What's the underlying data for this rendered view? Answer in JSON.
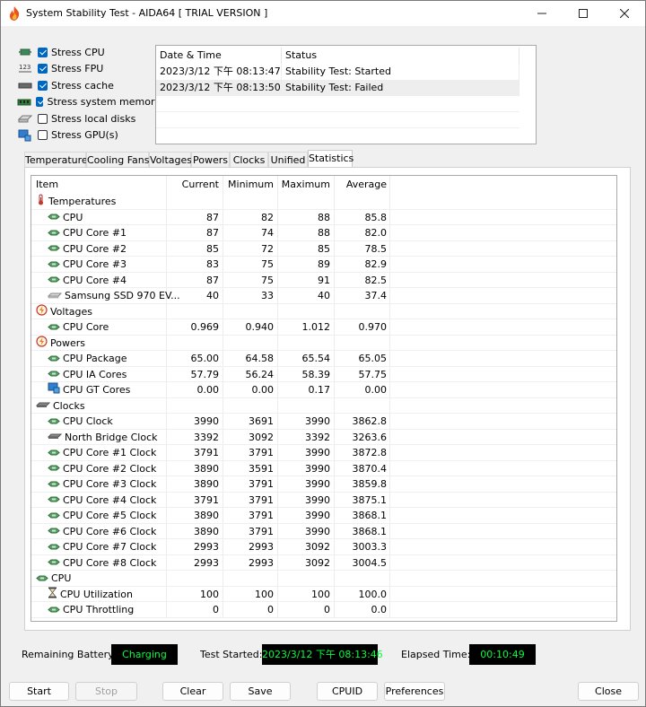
{
  "window": {
    "title": "System Stability Test - AIDA64  [ TRIAL VERSION ]",
    "controls": [
      "minimize",
      "maximize",
      "close"
    ]
  },
  "stress_options": [
    {
      "label": "Stress CPU",
      "checked": true,
      "icon": "cpu-chip-icon"
    },
    {
      "label": "Stress FPU",
      "checked": true,
      "icon": "fpu-123-icon"
    },
    {
      "label": "Stress cache",
      "checked": true,
      "icon": "cache-chip-icon"
    },
    {
      "label": "Stress system memory",
      "checked": true,
      "icon": "memory-module-icon"
    },
    {
      "label": "Stress local disks",
      "checked": false,
      "icon": "disk-drive-icon"
    },
    {
      "label": "Stress GPU(s)",
      "checked": false,
      "icon": "gpu-monitor-icon"
    }
  ],
  "log": {
    "headers": [
      "Date & Time",
      "Status"
    ],
    "rows": [
      {
        "datetime": "2023/3/12 下午 08:13:47",
        "status": "Stability Test: Started"
      },
      {
        "datetime": "2023/3/12 下午 08:13:50",
        "status": "Stability Test: Failed"
      }
    ]
  },
  "tabs": [
    "Temperatures",
    "Cooling Fans",
    "Voltages",
    "Powers",
    "Clocks",
    "Unified",
    "Statistics"
  ],
  "active_tab": "Statistics",
  "stats": {
    "headers": {
      "item": "Item",
      "current": "Current",
      "minimum": "Minimum",
      "maximum": "Maximum",
      "average": "Average"
    },
    "rows": [
      {
        "type": "group",
        "label": "Temperatures",
        "icon": "thermometer-icon"
      },
      {
        "type": "item",
        "label": "CPU",
        "icon": "sensor-icon",
        "current": "87",
        "minimum": "82",
        "maximum": "88",
        "average": "85.8"
      },
      {
        "type": "item",
        "label": "CPU Core #1",
        "icon": "sensor-icon",
        "current": "87",
        "minimum": "74",
        "maximum": "88",
        "average": "82.0"
      },
      {
        "type": "item",
        "label": "CPU Core #2",
        "icon": "sensor-icon",
        "current": "85",
        "minimum": "72",
        "maximum": "85",
        "average": "78.5"
      },
      {
        "type": "item",
        "label": "CPU Core #3",
        "icon": "sensor-icon",
        "current": "83",
        "minimum": "75",
        "maximum": "89",
        "average": "82.9"
      },
      {
        "type": "item",
        "label": "CPU Core #4",
        "icon": "sensor-icon",
        "current": "87",
        "minimum": "75",
        "maximum": "91",
        "average": "82.5"
      },
      {
        "type": "item",
        "label": "Samsung SSD 970 EV...",
        "icon": "ssd-icon",
        "current": "40",
        "minimum": "33",
        "maximum": "40",
        "average": "37.4"
      },
      {
        "type": "group",
        "label": "Voltages",
        "icon": "voltage-icon"
      },
      {
        "type": "item",
        "label": "CPU Core",
        "icon": "sensor-icon",
        "current": "0.969",
        "minimum": "0.940",
        "maximum": "1.012",
        "average": "0.970"
      },
      {
        "type": "group",
        "label": "Powers",
        "icon": "power-icon"
      },
      {
        "type": "item",
        "label": "CPU Package",
        "icon": "sensor-icon",
        "current": "65.00",
        "minimum": "64.58",
        "maximum": "65.54",
        "average": "65.05"
      },
      {
        "type": "item",
        "label": "CPU IA Cores",
        "icon": "sensor-icon",
        "current": "57.79",
        "minimum": "56.24",
        "maximum": "58.39",
        "average": "57.75"
      },
      {
        "type": "item",
        "label": "CPU GT Cores",
        "icon": "gpu-monitor-icon",
        "current": "0.00",
        "minimum": "0.00",
        "maximum": "0.17",
        "average": "0.00"
      },
      {
        "type": "group",
        "label": "Clocks",
        "icon": "clock-chip-icon"
      },
      {
        "type": "item",
        "label": "CPU Clock",
        "icon": "sensor-icon",
        "current": "3990",
        "minimum": "3691",
        "maximum": "3990",
        "average": "3862.8"
      },
      {
        "type": "item",
        "label": "North Bridge Clock",
        "icon": "chip-icon",
        "current": "3392",
        "minimum": "3092",
        "maximum": "3392",
        "average": "3263.6"
      },
      {
        "type": "item",
        "label": "CPU Core #1 Clock",
        "icon": "sensor-icon",
        "current": "3791",
        "minimum": "3791",
        "maximum": "3990",
        "average": "3872.8"
      },
      {
        "type": "item",
        "label": "CPU Core #2 Clock",
        "icon": "sensor-icon",
        "current": "3890",
        "minimum": "3591",
        "maximum": "3990",
        "average": "3870.4"
      },
      {
        "type": "item",
        "label": "CPU Core #3 Clock",
        "icon": "sensor-icon",
        "current": "3890",
        "minimum": "3791",
        "maximum": "3990",
        "average": "3859.8"
      },
      {
        "type": "item",
        "label": "CPU Core #4 Clock",
        "icon": "sensor-icon",
        "current": "3791",
        "minimum": "3791",
        "maximum": "3990",
        "average": "3875.1"
      },
      {
        "type": "item",
        "label": "CPU Core #5 Clock",
        "icon": "sensor-icon",
        "current": "3890",
        "minimum": "3791",
        "maximum": "3990",
        "average": "3868.1"
      },
      {
        "type": "item",
        "label": "CPU Core #6 Clock",
        "icon": "sensor-icon",
        "current": "3890",
        "minimum": "3791",
        "maximum": "3990",
        "average": "3868.1"
      },
      {
        "type": "item",
        "label": "CPU Core #7 Clock",
        "icon": "sensor-icon",
        "current": "2993",
        "minimum": "2993",
        "maximum": "3092",
        "average": "3003.3"
      },
      {
        "type": "item",
        "label": "CPU Core #8 Clock",
        "icon": "sensor-icon",
        "current": "2993",
        "minimum": "2993",
        "maximum": "3092",
        "average": "3004.5"
      },
      {
        "type": "group",
        "label": "CPU",
        "icon": "sensor-icon"
      },
      {
        "type": "item",
        "label": "CPU Utilization",
        "icon": "hourglass-icon",
        "current": "100",
        "minimum": "100",
        "maximum": "100",
        "average": "100.0"
      },
      {
        "type": "item",
        "label": "CPU Throttling",
        "icon": "sensor-icon",
        "current": "0",
        "minimum": "0",
        "maximum": "0",
        "average": "0.0"
      }
    ]
  },
  "status": {
    "battery_label": "Remaining Battery:",
    "battery_value": "Charging",
    "started_label": "Test Started:",
    "started_value": "2023/3/12 下午 08:13:46",
    "elapsed_label": "Elapsed Time:",
    "elapsed_value": "00:10:49"
  },
  "buttons": {
    "start": "Start",
    "stop": "Stop",
    "clear": "Clear",
    "save": "Save",
    "cpuid": "CPUID",
    "preferences": "Preferences",
    "close": "Close"
  },
  "colors": {
    "status_box_bg": "#000000",
    "status_box_text": "#00ff3c",
    "checkbox_accent": "#0067c0"
  }
}
